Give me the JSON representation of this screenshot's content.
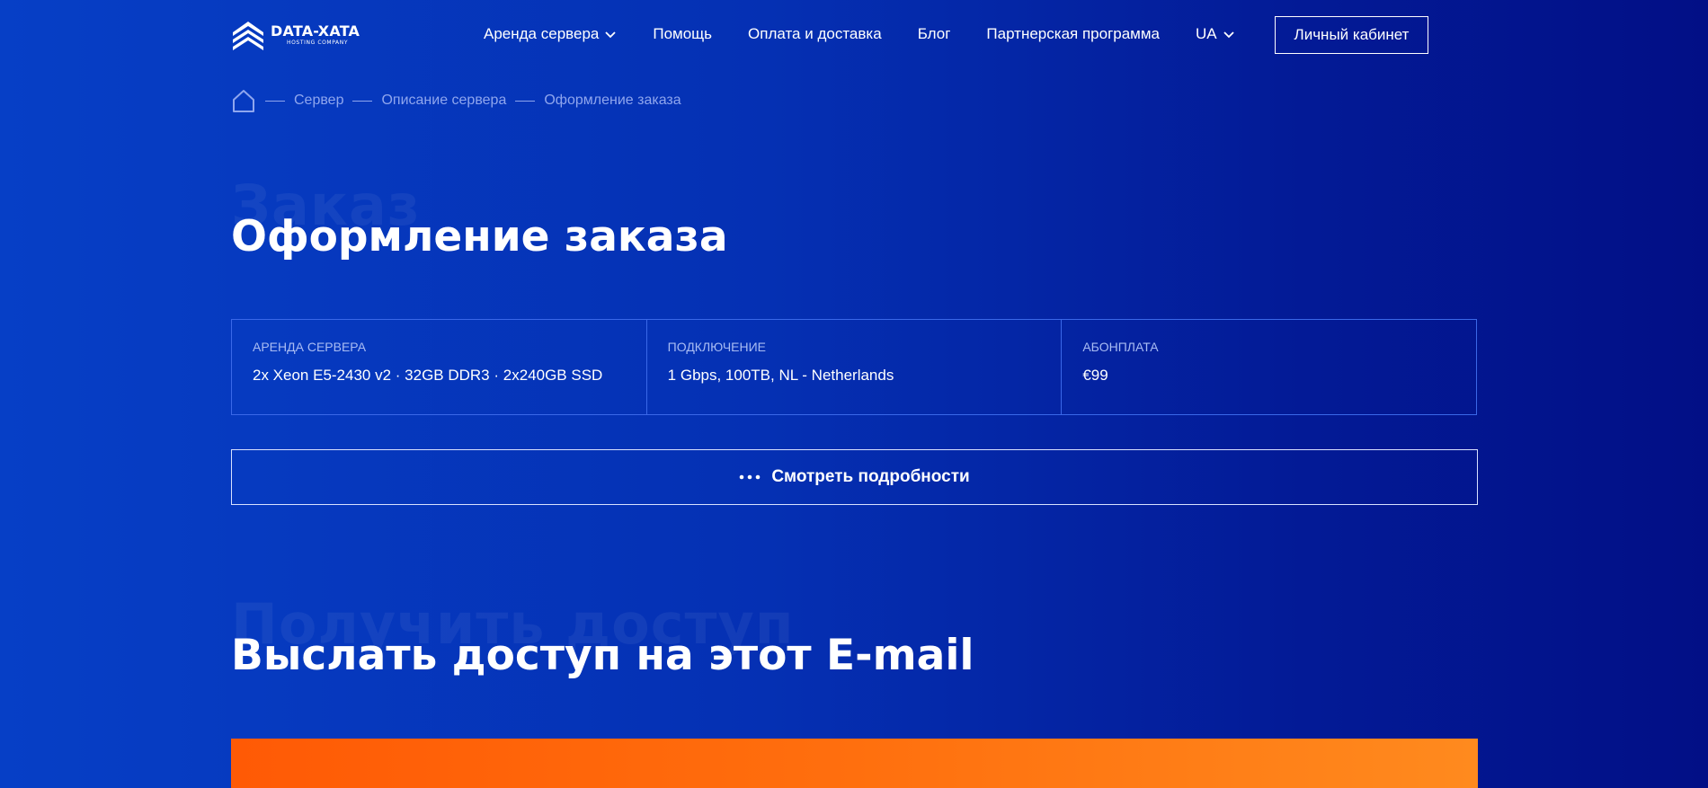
{
  "header": {
    "logo": {
      "title": "DATA-XATA",
      "subtitle": "HOSTING COMPANY"
    },
    "nav": [
      {
        "label": "Аренда сервера",
        "has_dropdown": true
      },
      {
        "label": "Помощь",
        "has_dropdown": false
      },
      {
        "label": "Оплата и доставка",
        "has_dropdown": false
      },
      {
        "label": "Блог",
        "has_dropdown": false
      },
      {
        "label": "Партнерская программа",
        "has_dropdown": false
      },
      {
        "label": "UA",
        "has_dropdown": true
      }
    ],
    "cabinet_label": "Личный кабинет"
  },
  "breadcrumb": {
    "home_icon": "home-icon",
    "items": [
      "Сервер",
      "Описание сервера",
      "Оформление заказа"
    ]
  },
  "order_section": {
    "ghost_text": "Заказ",
    "title": "Оформление заказа",
    "cards": [
      {
        "label": "Аренда сервера",
        "value": "2x Xeon E5-2430 v2 · 32GB DDR3 · 2x240GB SSD"
      },
      {
        "label": "Подключение",
        "value": "1 Gbps, 100TB, NL - Netherlands"
      },
      {
        "label": "Абонплата",
        "value": "€99"
      }
    ],
    "details_label": "Смотреть подробности"
  },
  "access_section": {
    "ghost_text": "Получить доступ",
    "title": "Выслать доступ на этот E-mail"
  },
  "colors": {
    "bg_left": "#063fc6",
    "bg_right": "#020f86",
    "accent_orange": "#ff6f0e",
    "card_border": "#3a68e8"
  }
}
